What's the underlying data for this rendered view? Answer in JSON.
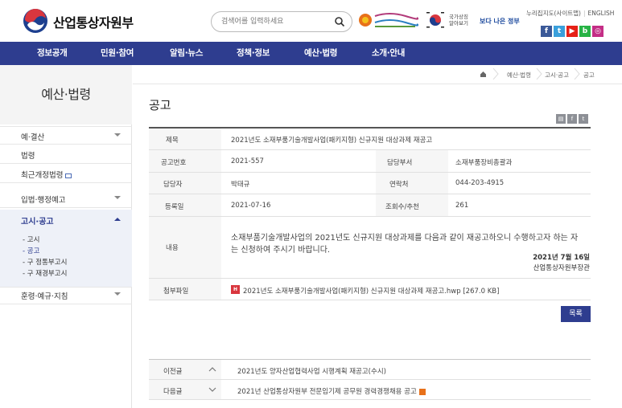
{
  "header": {
    "logo_text": "산업통상자원부",
    "search_placeholder": "검색어를 입력하세요",
    "banner_gov": "국가상징\n알아보기",
    "banner_better": "보다 나은 정부",
    "util": {
      "sitemap": "누리집지도(사이트맵)",
      "english": "ENGLISH"
    },
    "sns": [
      {
        "label": "f",
        "color": "#3b5998"
      },
      {
        "label": "t",
        "color": "#3aa0dc"
      },
      {
        "label": "▶",
        "color": "#e62117"
      },
      {
        "label": "b",
        "color": "#27b345"
      },
      {
        "label": "◎",
        "color": "#c42e86"
      }
    ]
  },
  "gnb": [
    "정보공개",
    "민원·참여",
    "알림·뉴스",
    "정책·정보",
    "예산·법령",
    "소개·안내"
  ],
  "lnb": {
    "title": "예산·법령",
    "items": [
      "예·결산",
      "법령",
      "최근개정법령",
      "입법·행정예고"
    ],
    "active": "고시·공고",
    "subs": [
      "- 고시",
      "- 공고",
      "- 구 정통부고시",
      "- 구 재경부고시"
    ],
    "after": "훈령·예규·지침"
  },
  "breadcrumb": [
    "예산·법령",
    "고시·공고",
    "공고"
  ],
  "page_title": "공고",
  "notice": {
    "title_label": "제목",
    "title": "2021년도 소재부품기술개발사업(패키지형) 신규지원 대상과제 재공고",
    "no_label": "공고번호",
    "no": "2021-557",
    "dept_label": "담당부서",
    "dept": "소재부품장비총괄과",
    "person_label": "담당자",
    "person": "박태규",
    "contact_label": "연락처",
    "contact": "044-203-4915",
    "date_label": "등록일",
    "date": "2021-07-16",
    "views_label": "조회수/추천",
    "views": "261",
    "content_label": "내용",
    "content": "소재부품기술개발사업의 2021년도 신규지원 대상과제를 다음과 같이 재공고하오니 수행하고자 하는 자는 신청하여 주시기 바랍니다.",
    "sign_date": "2021년 7월 16일",
    "sign_org": "산업통상자원부장관",
    "file_label": "첨부파일",
    "file": "2021년도 소재부품기술개발사업(패키지형) 신규지원 대상과제 재공고.hwp [267.0 KB]"
  },
  "list_button": "목록",
  "prev": {
    "label": "이전글",
    "text": "2021년도 양자산업협력사업 시행계획 재공고(수시)"
  },
  "next": {
    "label": "다음글",
    "text": "2021년 산업통상자원부 전문임기제 공무원 경력경쟁채용 공고"
  }
}
